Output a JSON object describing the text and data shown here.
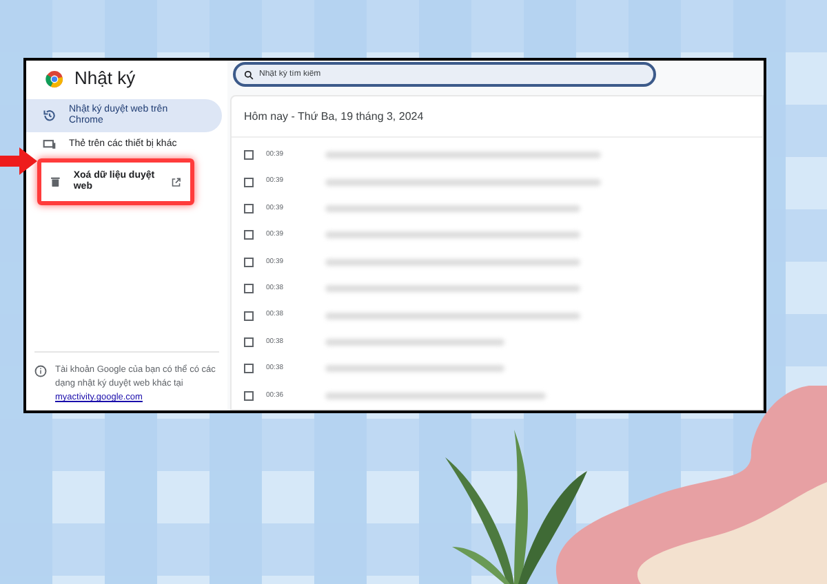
{
  "app": {
    "title": "Nhật ký"
  },
  "sidebar": {
    "items": [
      {
        "label": "Nhật ký duyệt web trên Chrome",
        "selected": true,
        "kind": "history"
      },
      {
        "label": "Thẻ trên các thiết bị khác",
        "selected": false,
        "kind": "devices"
      },
      {
        "label": "Xoá dữ liệu duyệt web",
        "selected": false,
        "kind": "clear",
        "highlighted": true
      }
    ],
    "footer": {
      "text": "Tài khoản Google của bạn có thể có các dạng nhật ký duyệt web khác tại",
      "link": "myactivity.google.com"
    }
  },
  "search": {
    "placeholder": "Nhật ký tìm kiếm"
  },
  "history": {
    "heading": "Hôm nay - Thứ Ba, 19 tháng 3, 2024",
    "rows": [
      {
        "time": "00:39",
        "checked": false
      },
      {
        "time": "00:39",
        "checked": false
      },
      {
        "time": "00:39",
        "checked": false
      },
      {
        "time": "00:39",
        "checked": false
      },
      {
        "time": "00:39",
        "checked": false
      },
      {
        "time": "00:38",
        "checked": false
      },
      {
        "time": "00:38",
        "checked": false
      },
      {
        "time": "00:38",
        "checked": false
      },
      {
        "time": "00:38",
        "checked": false
      },
      {
        "time": "00:36",
        "checked": false
      }
    ]
  }
}
